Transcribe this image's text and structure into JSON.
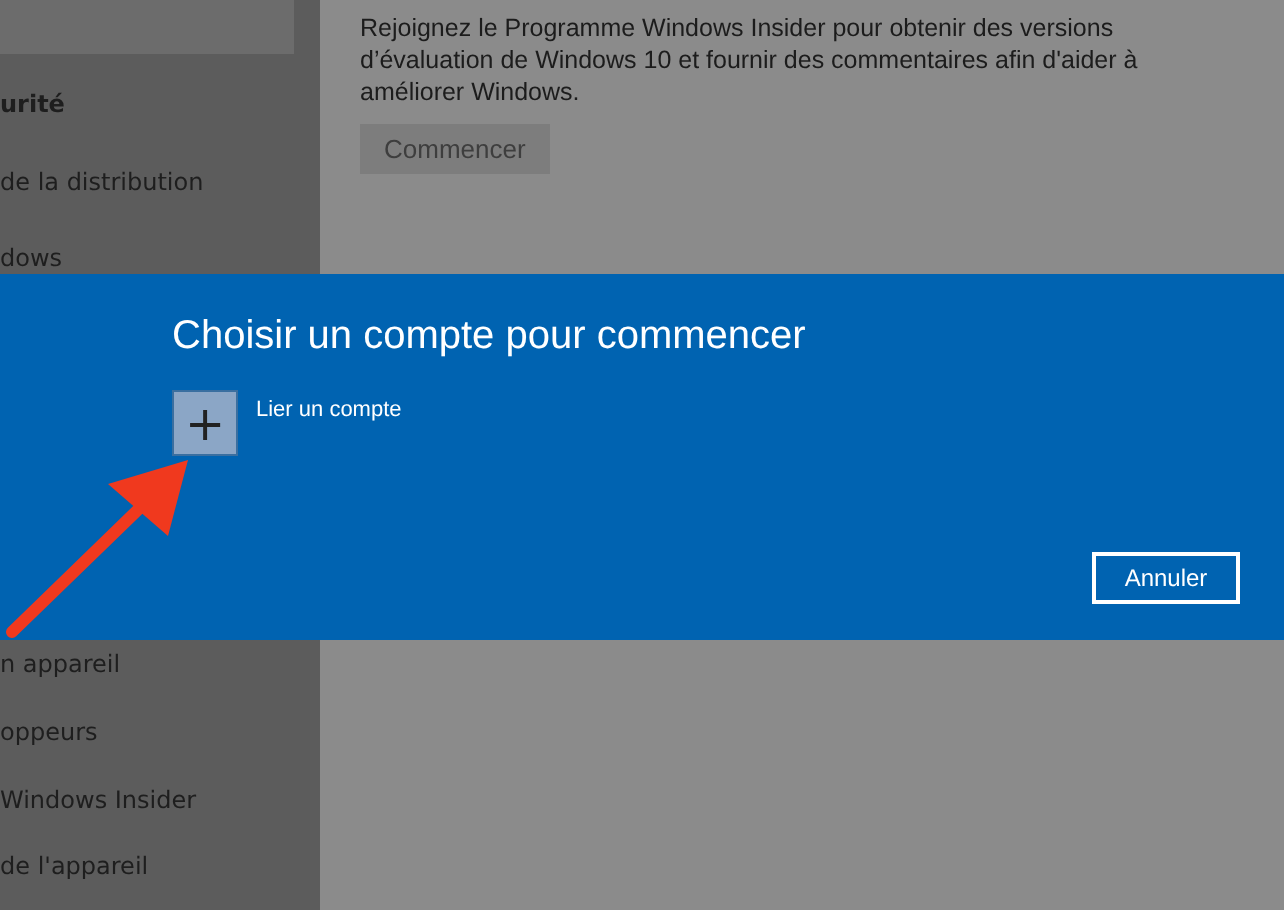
{
  "sidebar_top": {
    "section_heading": "urité",
    "items": [
      {
        "label": "de la distribution"
      },
      {
        "label": "dows"
      }
    ]
  },
  "content": {
    "description": "Rejoignez le Programme Windows Insider pour obtenir des versions d’évaluation de Windows 10 et fournir des commentaires afin d'aider à améliorer Windows.",
    "button": {
      "label": "Commencer",
      "disabled": true
    }
  },
  "dialog": {
    "title": "Choisir un compte pour commencer",
    "add_account": {
      "icon": "+",
      "label": "Lier un compte"
    },
    "cancel_button": "Annuler"
  },
  "sidebar_bottom": {
    "items": [
      {
        "label": "n appareil"
      },
      {
        "label": "oppeurs"
      },
      {
        "label": "Windows Insider"
      },
      {
        "label": "de l'appareil"
      }
    ]
  }
}
